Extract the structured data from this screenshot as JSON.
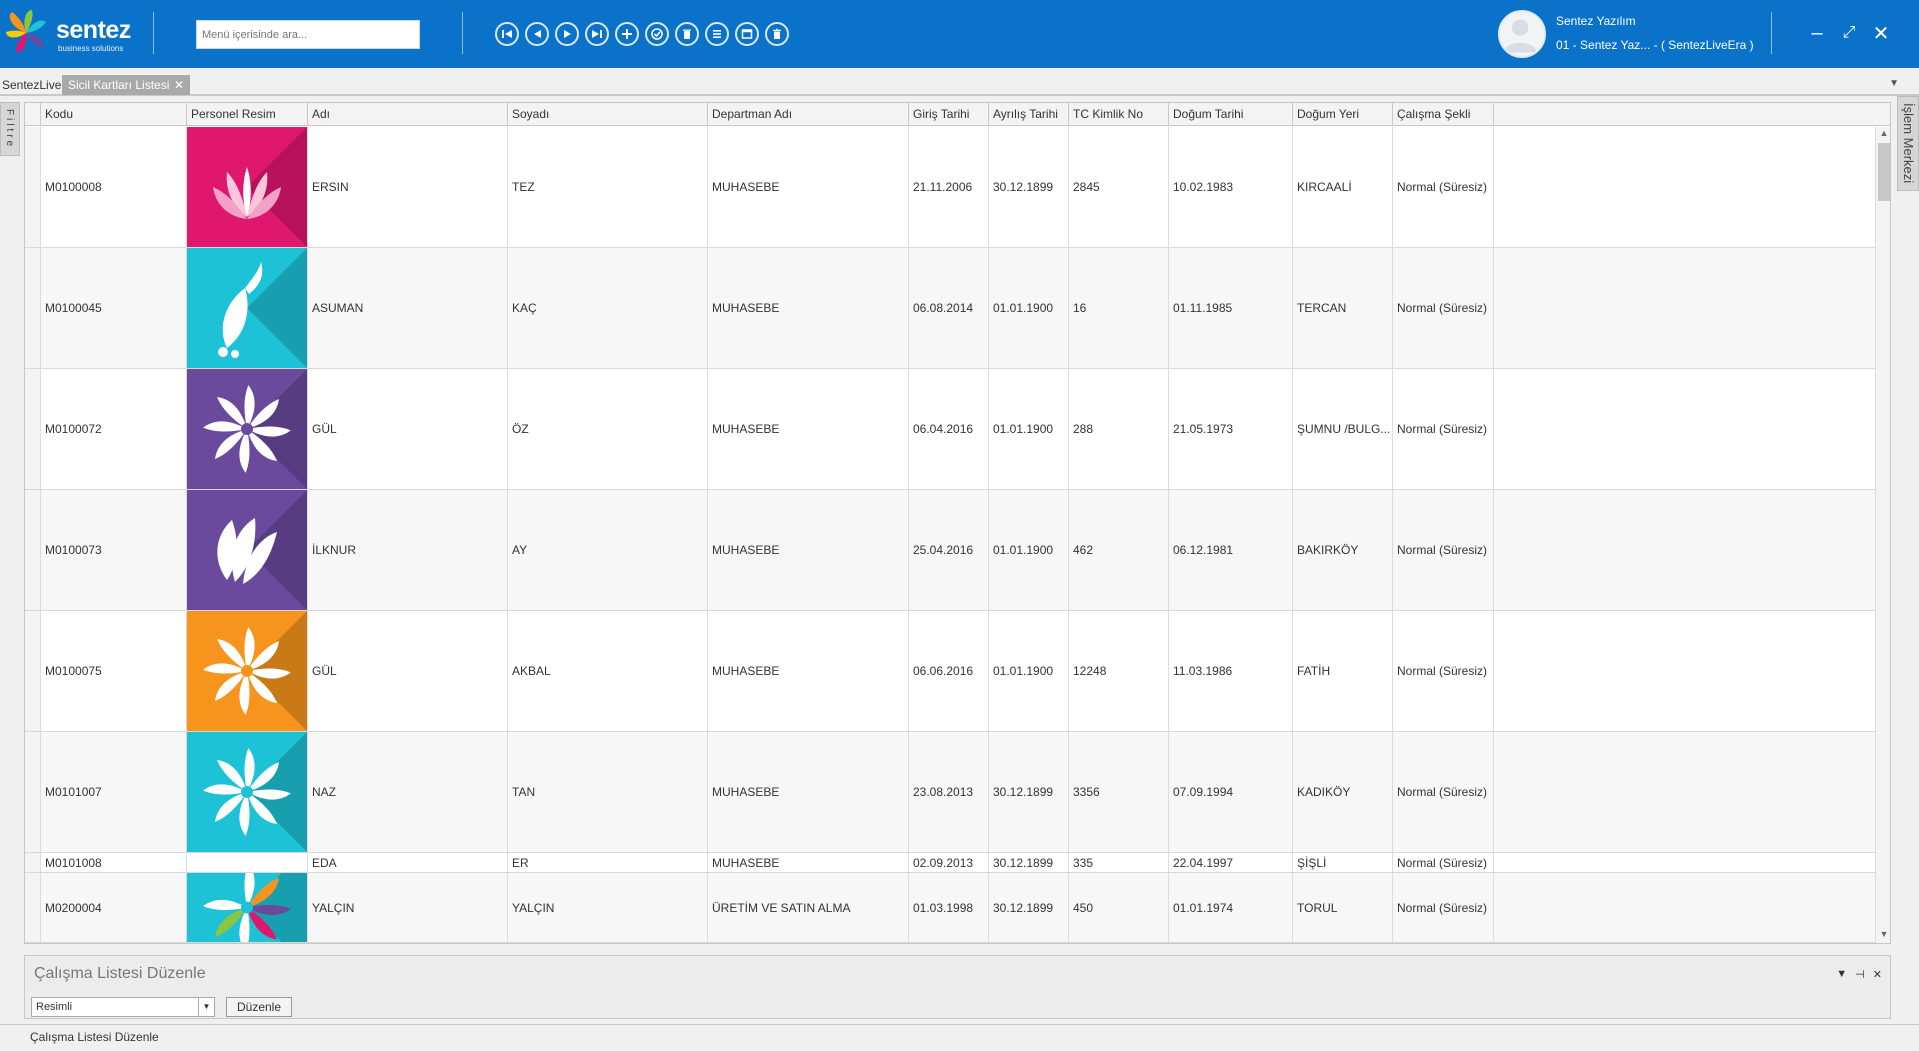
{
  "app": {
    "logo_text": "sentez",
    "logo_sub": "business solutions",
    "search_placeholder": "Menü içerisinde ara..."
  },
  "toolbar_icons": [
    "first-record-icon",
    "previous-record-icon",
    "next-record-icon",
    "last-record-icon",
    "add-icon",
    "approve-icon",
    "delete-icon",
    "list-icon",
    "window-icon",
    "trash-icon"
  ],
  "user": {
    "name": "Sentez Yazılım",
    "company": "01 - Sentez Yaz... - ( SentezLiveEra )"
  },
  "tabs": [
    {
      "label": "SentezLive"
    },
    {
      "label": "Sicil Kartları Listesi"
    }
  ],
  "side": {
    "filter_label": "Filtre",
    "right_label": "İşlem Merkezi"
  },
  "columns": [
    "Kodu",
    "Personel Resim",
    "Adı",
    "Soyadı",
    "Departman Adı",
    "Giriş Tarihi",
    "Ayrılış Tarihi",
    "TC Kimlik No",
    "Doğum Tarihi",
    "Doğum Yeri",
    "Çalışma Şekli"
  ],
  "rows": [
    {
      "code": "M0100008",
      "img": {
        "type": "lotus",
        "bg": "#e0176f"
      },
      "name": "ERSIN",
      "surname": "TEZ",
      "dept": "MUHASEBE",
      "start": "21.11.2006",
      "end": "30.12.1899",
      "tc": "2845",
      "birth": "10.02.1983",
      "place": "KIRCAALİ",
      "work": "Normal (Süresiz)"
    },
    {
      "code": "M0100045",
      "img": {
        "type": "tulip",
        "bg": "#1ec2d6"
      },
      "name": "ASUMAN",
      "surname": "KAÇ",
      "dept": "MUHASEBE",
      "start": "06.08.2014",
      "end": "01.01.1900",
      "tc": "16",
      "birth": "01.11.1985",
      "place": "TERCAN",
      "work": "Normal (Süresiz)"
    },
    {
      "code": "M0100072",
      "img": {
        "type": "pinwheel",
        "bg": "#6b4a9e"
      },
      "name": "GÜL",
      "surname": "ÖZ",
      "dept": "MUHASEBE",
      "start": "06.04.2016",
      "end": "01.01.1900",
      "tc": "288",
      "birth": "21.05.1973",
      "place": "ŞUMNU /BULG...",
      "work": "Normal (Süresiz)"
    },
    {
      "code": "M0100073",
      "img": {
        "type": "petals",
        "bg": "#6b4a9e"
      },
      "name": "İLKNUR",
      "surname": "AY",
      "dept": "MUHASEBE",
      "start": "25.04.2016",
      "end": "01.01.1900",
      "tc": "462",
      "birth": "06.12.1981",
      "place": "BAKIRKÖY",
      "work": "Normal (Süresiz)"
    },
    {
      "code": "M0100075",
      "img": {
        "type": "pinwheel",
        "bg": "#f7941d"
      },
      "name": "GÜL",
      "surname": "AKBAL",
      "dept": "MUHASEBE",
      "start": "06.06.2016",
      "end": "01.01.1900",
      "tc": "12248",
      "birth": "11.03.1986",
      "place": "FATİH",
      "work": "Normal (Süresiz)"
    },
    {
      "code": "M0101007",
      "img": {
        "type": "pinwheel",
        "bg": "#1ec2d6"
      },
      "name": "NAZ",
      "surname": "TAN",
      "dept": "MUHASEBE",
      "start": "23.08.2013",
      "end": "30.12.1899",
      "tc": "3356",
      "birth": "07.09.1994",
      "place": "KADIKÖY",
      "work": "Normal (Süresiz)"
    },
    {
      "code": "M0101008",
      "img": null,
      "name": "EDA",
      "surname": "ER",
      "dept": "MUHASEBE",
      "start": "02.09.2013",
      "end": "30.12.1899",
      "tc": "335",
      "birth": "22.04.1997",
      "place": "ŞİŞLİ",
      "work": "Normal (Süresiz)"
    },
    {
      "code": "M0200004",
      "img": {
        "type": "pinwheel-multi",
        "bg": "#1ec2d6"
      },
      "name": "YALÇIN",
      "surname": "YALÇIN",
      "dept": "ÜRETİM VE SATIN ALMA",
      "start": "01.03.1998",
      "end": "30.12.1899",
      "tc": "450",
      "birth": "01.01.1974",
      "place": "TORUL",
      "work": "Normal (Süresiz)"
    }
  ],
  "panel": {
    "title": "Çalışma Listesi Düzenle",
    "select_value": "Resimli",
    "edit_button": "Düzenle"
  },
  "status": {
    "text": "Çalışma Listesi Düzenle"
  }
}
